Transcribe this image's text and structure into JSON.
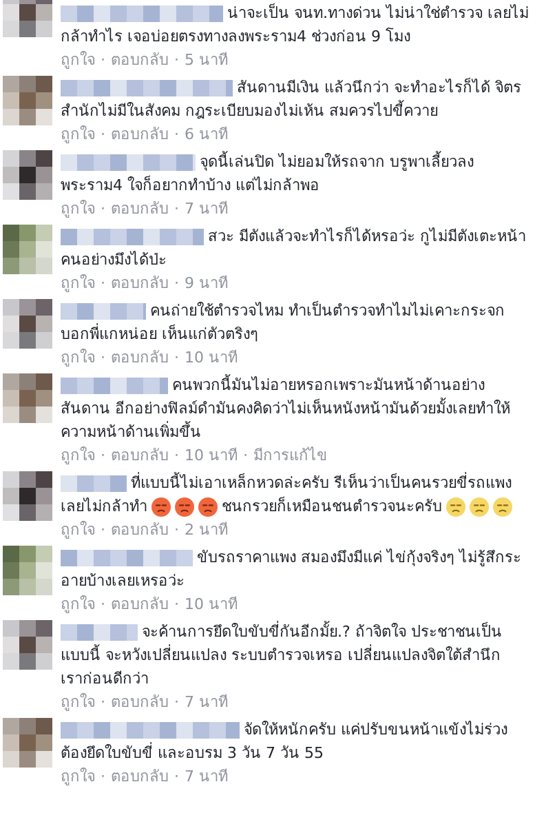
{
  "separator": "·",
  "comments": [
    {
      "lines": [
        "น่าจะเป็น จนท.ทางด่วน ไม่น่าใช่ตำรวจ เลยไม่",
        "กล้าทำไร เจอบ่อยตรงทางลงพระราม4 ช่วงก่อน 9 โมง"
      ],
      "actions": [
        "ถูกใจ",
        "ตอบกลับ"
      ],
      "time": "5 นาที"
    },
    {
      "lines": [
        "สันดานมีเงิน แล้วนึกว่า จะทำอะไรก็ได้ จิตร",
        "สำนักไม่มีในสังคม กฎระเบียบมองไม่เห้น สมควรไปขี้ควาย"
      ],
      "actions": [
        "ถูกใจ",
        "ตอบกลับ"
      ],
      "time": "6 นาที"
    },
    {
      "lines": [
        "จุดนี้เล่นปิด ไม่ยอมให้รถจาก บรูพาเลี้ยวลง",
        "พระราม4 ใจก็อยากทำบ้าง แต่ไม่กล้าพอ"
      ],
      "actions": [
        "ถูกใจ",
        "ตอบกลับ"
      ],
      "time": "7 นาที"
    },
    {
      "lines": [
        "สวะ มีตังแล้วจะทำไรก็ได้หรอว่ะ กูไม่มีตังเตะหน้า",
        "คนอย่างมึงได้ป่ะ"
      ],
      "actions": [
        "ถูกใจ",
        "ตอบกลับ"
      ],
      "time": "9 นาที"
    },
    {
      "lines": [
        "คนถ่ายใช้ตำรวจไหม ทำเป็นตำรวจทำไมไม่เคาะกระจก",
        "บอกพี่แกหน่อย เห็นแก่ตัวตริงๆ"
      ],
      "actions": [
        "ถูกใจ",
        "ตอบกลับ"
      ],
      "time": "10 นาที"
    },
    {
      "lines": [
        "คนพวกนี้มันไม่อายหรอกเพราะมันหน้าด้านอย่าง",
        "สันดาน อีกอย่างฟิลม์ดำมันคงคิดว่าไม่เห็นหนังหน้ามันด้วยมั้งเลยทำให้",
        "ความหน้าด้านเพิ่มขึ้น"
      ],
      "actions": [
        "ถูกใจ",
        "ตอบกลับ"
      ],
      "time": "10 นาที",
      "edited": "มีการแก้ไข"
    },
    {
      "lines": [
        "ที่แบบนี้ไม่เอาเหล็กหวดล่ะครับ รีเห็นว่าเป็นคนรวยขี่รถแพง",
        [
          {
            "kind": "text",
            "text": "เลยไม่กล้าทำ"
          },
          {
            "kind": "angry"
          },
          {
            "kind": "angry"
          },
          {
            "kind": "angry"
          },
          {
            "kind": "text",
            "text": "ชนกรวยก็เหมือนชนตำรวจนะครับ"
          },
          {
            "kind": "squint"
          },
          {
            "kind": "squint"
          },
          {
            "kind": "squint"
          }
        ]
      ],
      "actions": [
        "ถูกใจ",
        "ตอบกลับ"
      ],
      "time": "2 นาที"
    },
    {
      "lines": [
        "ขับรถราคาแพง สมองมึงมีแค่ ไข่กุ้งจริงๆ ไม่รู้สึกระ",
        "อายบ้างเลยเหรอว่ะ"
      ],
      "actions": [
        "ถูกใจ",
        "ตอบกลับ"
      ],
      "time": "10 นาที"
    },
    {
      "lines": [
        "จะค้านการยึดใบขับขี่กันอีกมั้ย.? ถ้าจิตใจ ประชาชนเป็น",
        "แบบนี้ จะหวังเปลี่ยนแปลง ระบบตำรวจเหรอ เปลี่ยนแปลงจิตใต้สำนึก",
        "เราก่อนดีกว่า"
      ],
      "actions": [
        "ถูกใจ",
        "ตอบกลับ"
      ],
      "time": "7 นาที"
    },
    {
      "lines": [
        "จัดให้หนักครับ แค่ปรับขนหน้าแข้งไม่ร่วง",
        "ต้องยึดใบขับขี่ และอบรม 3 วัน 7 วัน 55"
      ],
      "actions": [
        "ถูกใจ",
        "ตอบกลับ"
      ],
      "time": "7 นาที"
    }
  ]
}
